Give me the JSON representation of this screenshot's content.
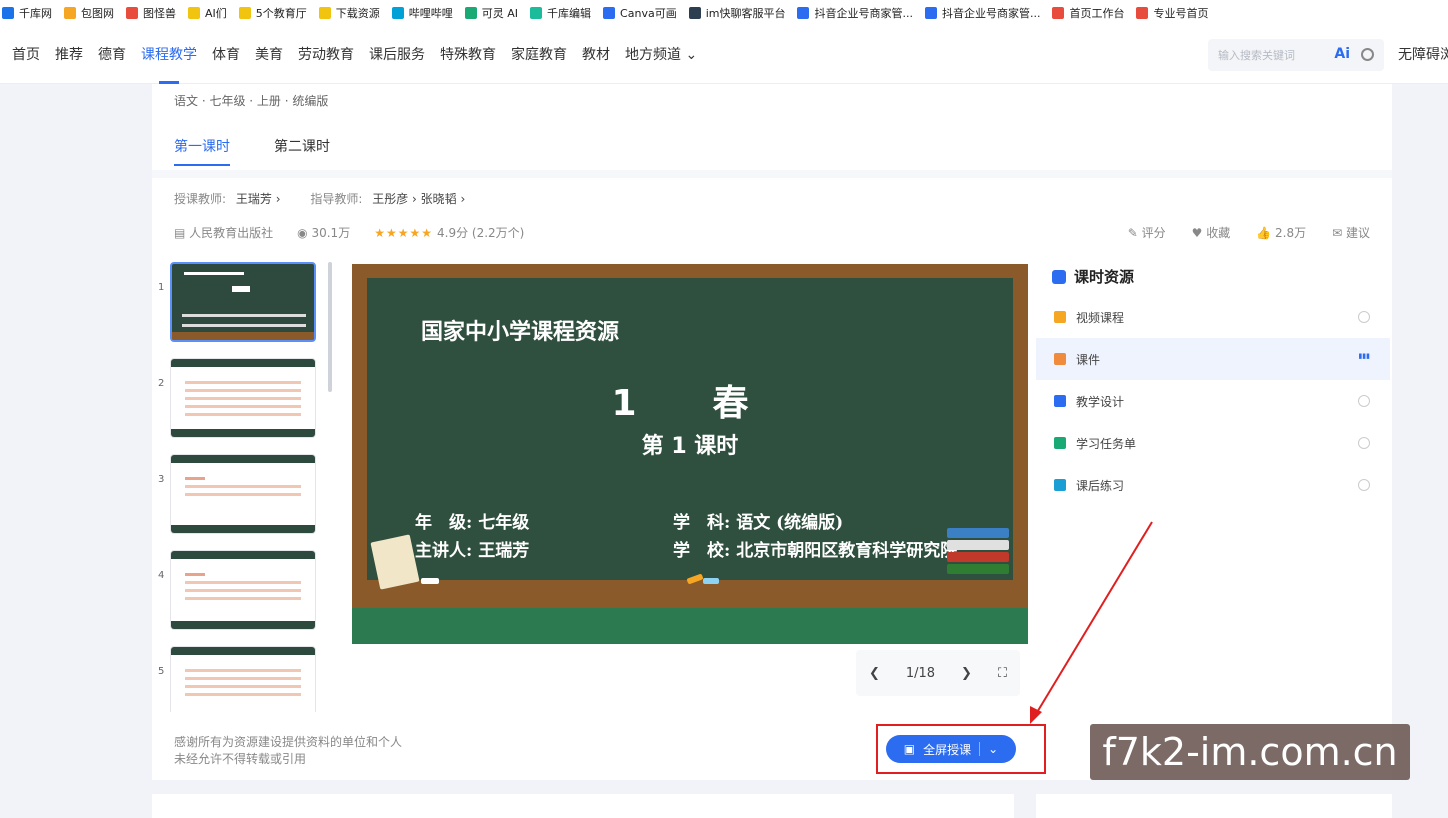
{
  "bookmarks": [
    {
      "label": "千库网",
      "color": "#1a73e8"
    },
    {
      "label": "包图网",
      "color": "#f5a623"
    },
    {
      "label": "图怪兽",
      "color": "#e74c3c"
    },
    {
      "label": "AI们",
      "color": "#f1c40f"
    },
    {
      "label": "5个教育厅",
      "color": "#f1c40f"
    },
    {
      "label": "下载资源",
      "color": "#f1c40f"
    },
    {
      "label": "哔哩哔哩",
      "color": "#00a1d6"
    },
    {
      "label": "可灵 AI",
      "color": "#19a974"
    },
    {
      "label": "千库编辑",
      "color": "#1abc9c"
    },
    {
      "label": "Canva可画",
      "color": "#2c6cf0"
    },
    {
      "label": "im快聊客服平台",
      "color": "#2c3e50"
    },
    {
      "label": "抖音企业号商家管...",
      "color": "#2c6cf0"
    },
    {
      "label": "抖音企业号商家管...",
      "color": "#2c6cf0"
    },
    {
      "label": "首页工作台",
      "color": "#e74c3c"
    },
    {
      "label": "专业号首页",
      "color": "#e74c3c"
    }
  ],
  "nav": {
    "items": [
      "首页",
      "推荐",
      "德育",
      "课程教学",
      "体育",
      "美育",
      "劳动教育",
      "课后服务",
      "特殊教育",
      "家庭教育",
      "教材",
      "地方频道 ⌄"
    ],
    "active_index": 3,
    "search_placeholder": "输入搜索关键词",
    "ai_label": "Ai",
    "accessibility": "无障碍浏"
  },
  "course": {
    "breadcrumb": "语文 · 七年级 · 上册 · 统编版",
    "tabs": [
      "第一课时",
      "第二课时"
    ],
    "teacher_label": "授课教师:",
    "teacher": "王瑞芳 ›",
    "advisor_label": "指导教师:",
    "advisors": "王彤彦 ›   张晓韬 ›",
    "publisher": "人民教育出版社",
    "views": "30.1万",
    "stars": "★★★★★",
    "rating": "4.9分 (2.2万个)",
    "actions": [
      "评分",
      "收藏",
      "2.8万",
      "建议"
    ]
  },
  "thumbs": [
    "1",
    "2",
    "3",
    "4",
    "5"
  ],
  "slide": {
    "header": "国家中小学课程资源",
    "title": "1　春",
    "subtitle": "第 1 课时",
    "grade": "年　级: 七年级",
    "subject": "学　科: 语文 (统编版)",
    "speaker": "主讲人: 王瑞芳",
    "school": "学　校: 北京市朝阳区教育科学研究院",
    "page": "1/18"
  },
  "resources": {
    "header": "课时资源",
    "items": [
      {
        "label": "视频课程",
        "color": "#f5a623"
      },
      {
        "label": "课件",
        "color": "#f08a3c"
      },
      {
        "label": "教学设计",
        "color": "#2c6cf0"
      },
      {
        "label": "学习任务单",
        "color": "#19a974"
      },
      {
        "label": "课后练习",
        "color": "#1a9ed4"
      }
    ]
  },
  "footer": {
    "line1": "感谢所有为资源建设提供资料的单位和个人",
    "line2": "未经允许不得转载或引用",
    "fullscreen": "全屏授课"
  },
  "watermark": "f7k2-im.com.cn"
}
